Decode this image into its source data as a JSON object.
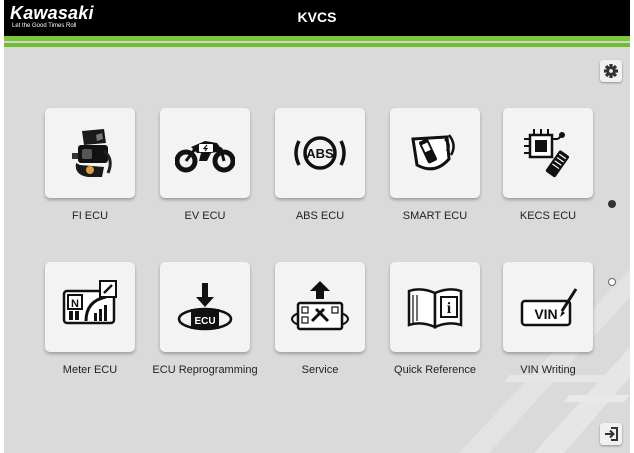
{
  "header": {
    "brand": "Kawasaki",
    "tagline": "Let the Good Times Roll",
    "title": "KVCS"
  },
  "menu": {
    "tiles": [
      {
        "label": "FI ECU",
        "icon": "engine-icon"
      },
      {
        "label": "EV ECU",
        "icon": "electric-motorcycle-icon"
      },
      {
        "label": "ABS ECU",
        "icon": "abs-icon"
      },
      {
        "label": "SMART ECU",
        "icon": "smart-key-icon"
      },
      {
        "label": "KECS ECU",
        "icon": "suspension-chip-icon"
      },
      {
        "label": "Meter ECU",
        "icon": "meter-icon"
      },
      {
        "label": "ECU Reprogramming",
        "icon": "ecu-download-icon"
      },
      {
        "label": "Service",
        "icon": "service-tools-icon"
      },
      {
        "label": "Quick Reference",
        "icon": "book-info-icon"
      },
      {
        "label": "VIN Writing",
        "icon": "vin-write-icon"
      }
    ]
  },
  "toolbar": {
    "settings_icon": "gear-icon",
    "exit_icon": "exit-icon"
  },
  "pagination": {
    "total_pages": 2,
    "current_page": 1
  },
  "colors": {
    "accent_green": "#7cc63a",
    "header_black": "#000000",
    "background_gray": "#dadada",
    "tile": "#f3f3f3"
  }
}
